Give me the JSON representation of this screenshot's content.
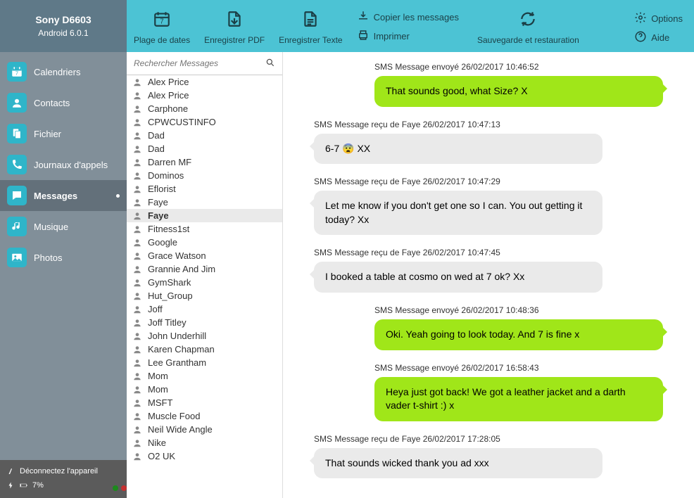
{
  "device": {
    "name": "Sony D6603",
    "os": "Android 6.0.1"
  },
  "toolbar": {
    "date_range": "Plage de dates",
    "save_pdf": "Enregistrer PDF",
    "save_text": "Enregistrer Texte",
    "copy_msgs": "Copier les messages",
    "print": "Imprimer",
    "backup": "Sauvegarde et restauration",
    "options": "Options",
    "help": "Aide"
  },
  "nav": {
    "items": [
      {
        "label": "Calendriers",
        "icon": "calendar"
      },
      {
        "label": "Contacts",
        "icon": "contacts"
      },
      {
        "label": "Fichier",
        "icon": "file"
      },
      {
        "label": "Journaux d'appels",
        "icon": "phone"
      },
      {
        "label": "Messages",
        "icon": "message",
        "active": true
      },
      {
        "label": "Musique",
        "icon": "music"
      },
      {
        "label": "Photos",
        "icon": "photo"
      }
    ]
  },
  "footer": {
    "disconnect": "Déconnectez l'appareil",
    "battery": "7%"
  },
  "search": {
    "placeholder": "Rechercher Messages"
  },
  "contacts": [
    "Alex Price",
    "Alex Price",
    "Carphone",
    "CPWCUSTINFO",
    "Dad",
    "Dad",
    "Darren  MF",
    "Dominos",
    "Eflorist",
    "Faye",
    "Faye",
    "Fitness1st",
    "Google",
    "Grace Watson",
    "Grannie And Jim",
    "GymShark",
    "Hut_Group",
    "Joff",
    "Joff Titley",
    "John Underhill",
    "Karen Chapman",
    "Lee Grantham",
    "Mom",
    "Mom",
    "MSFT",
    "Muscle Food",
    "Neil Wide Angle",
    "Nike",
    "O2 UK"
  ],
  "selected_contact_index": 10,
  "messages": [
    {
      "type": "sent",
      "meta": "SMS Message envoyé 26/02/2017 10:46:52",
      "text": "That sounds good, what Size? X"
    },
    {
      "type": "received",
      "meta": "SMS Message reçu de Faye 26/02/2017 10:47:13",
      "text": "6-7 😨 XX"
    },
    {
      "type": "received",
      "meta": "SMS Message reçu de Faye 26/02/2017 10:47:29",
      "text": "Let me know if you don't get one so I can. You out getting it today? Xx"
    },
    {
      "type": "received",
      "meta": "SMS Message reçu de Faye 26/02/2017 10:47:45",
      "text": "I booked a table at cosmo on wed at 7 ok? Xx"
    },
    {
      "type": "sent",
      "meta": "SMS Message envoyé 26/02/2017 10:48:36",
      "text": "Oki. Yeah going to look today. And 7 is fine x"
    },
    {
      "type": "sent",
      "meta": "SMS Message envoyé 26/02/2017 16:58:43",
      "text": "Heya just got back! We got a leather jacket and a darth vader t-shirt :) x"
    },
    {
      "type": "received",
      "meta": "SMS Message reçu de Faye 26/02/2017 17:28:05",
      "text": "That sounds wicked thank you ad xxx"
    }
  ]
}
